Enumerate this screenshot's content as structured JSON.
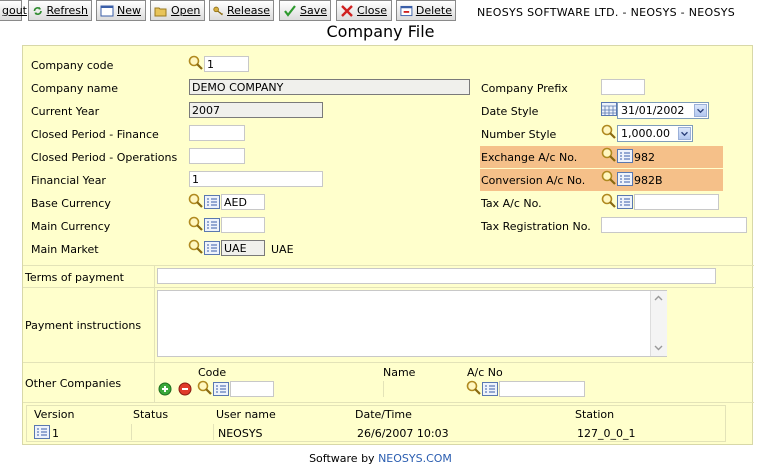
{
  "toolbar": {
    "logout_label": "gout",
    "refresh_label": "Refresh",
    "new_label": "New",
    "open_label": "Open",
    "release_label": "Release",
    "save_label": "Save",
    "close_label": "Close",
    "delete_label": "Delete"
  },
  "brand": "NEOSYS SOFTWARE LTD. - NEOSYS - NEOSYS",
  "page_title": "Company File",
  "form": {
    "company_code": {
      "label": "Company code",
      "value": "1"
    },
    "company_name": {
      "label": "Company name",
      "value": "DEMO COMPANY"
    },
    "current_year": {
      "label": "Current Year",
      "value": "2007"
    },
    "closed_finance": {
      "label": "Closed Period - Finance",
      "value": ""
    },
    "closed_operations": {
      "label": "Closed Period - Operations",
      "value": ""
    },
    "financial_year": {
      "label": "Financial Year",
      "value": "1"
    },
    "base_currency": {
      "label": "Base Currency",
      "value": "AED"
    },
    "main_currency": {
      "label": "Main Currency",
      "value": ""
    },
    "main_market": {
      "label": "Main Market",
      "value": "UAE",
      "description": "UAE"
    },
    "company_prefix": {
      "label": "Company Prefix",
      "value": ""
    },
    "date_style": {
      "label": "Date Style",
      "value": "31/01/2002"
    },
    "number_style": {
      "label": "Number Style",
      "value": "1,000.00"
    },
    "exchange_ac": {
      "label": "Exchange A/c No.",
      "value": "982"
    },
    "conversion_ac": {
      "label": "Conversion A/c No.",
      "value": "982B"
    },
    "tax_ac": {
      "label": "Tax A/c No.",
      "value": ""
    },
    "tax_registration": {
      "label": "Tax Registration No.",
      "value": ""
    },
    "terms_of_payment": {
      "label": "Terms of payment",
      "value": ""
    },
    "payment_instructions": {
      "label": "Payment instructions",
      "value": ""
    }
  },
  "other_companies": {
    "label": "Other Companies",
    "headers": {
      "code": "Code",
      "name": "Name",
      "ac_no": "A/c No"
    }
  },
  "version_table": {
    "headers": {
      "version": "Version",
      "status": "Status",
      "user": "User name",
      "datetime": "Date/Time",
      "station": "Station"
    },
    "row": {
      "version": "1",
      "status": "",
      "user": "NEOSYS",
      "datetime": "26/6/2007 10:03",
      "station": "127_0_0_1"
    }
  },
  "footer": {
    "prefix": "Software by ",
    "link": "NEOSYS.COM"
  },
  "colors": {
    "panel": "#ffffcc",
    "highlight": "#f5c089",
    "link": "#2a5db0"
  }
}
